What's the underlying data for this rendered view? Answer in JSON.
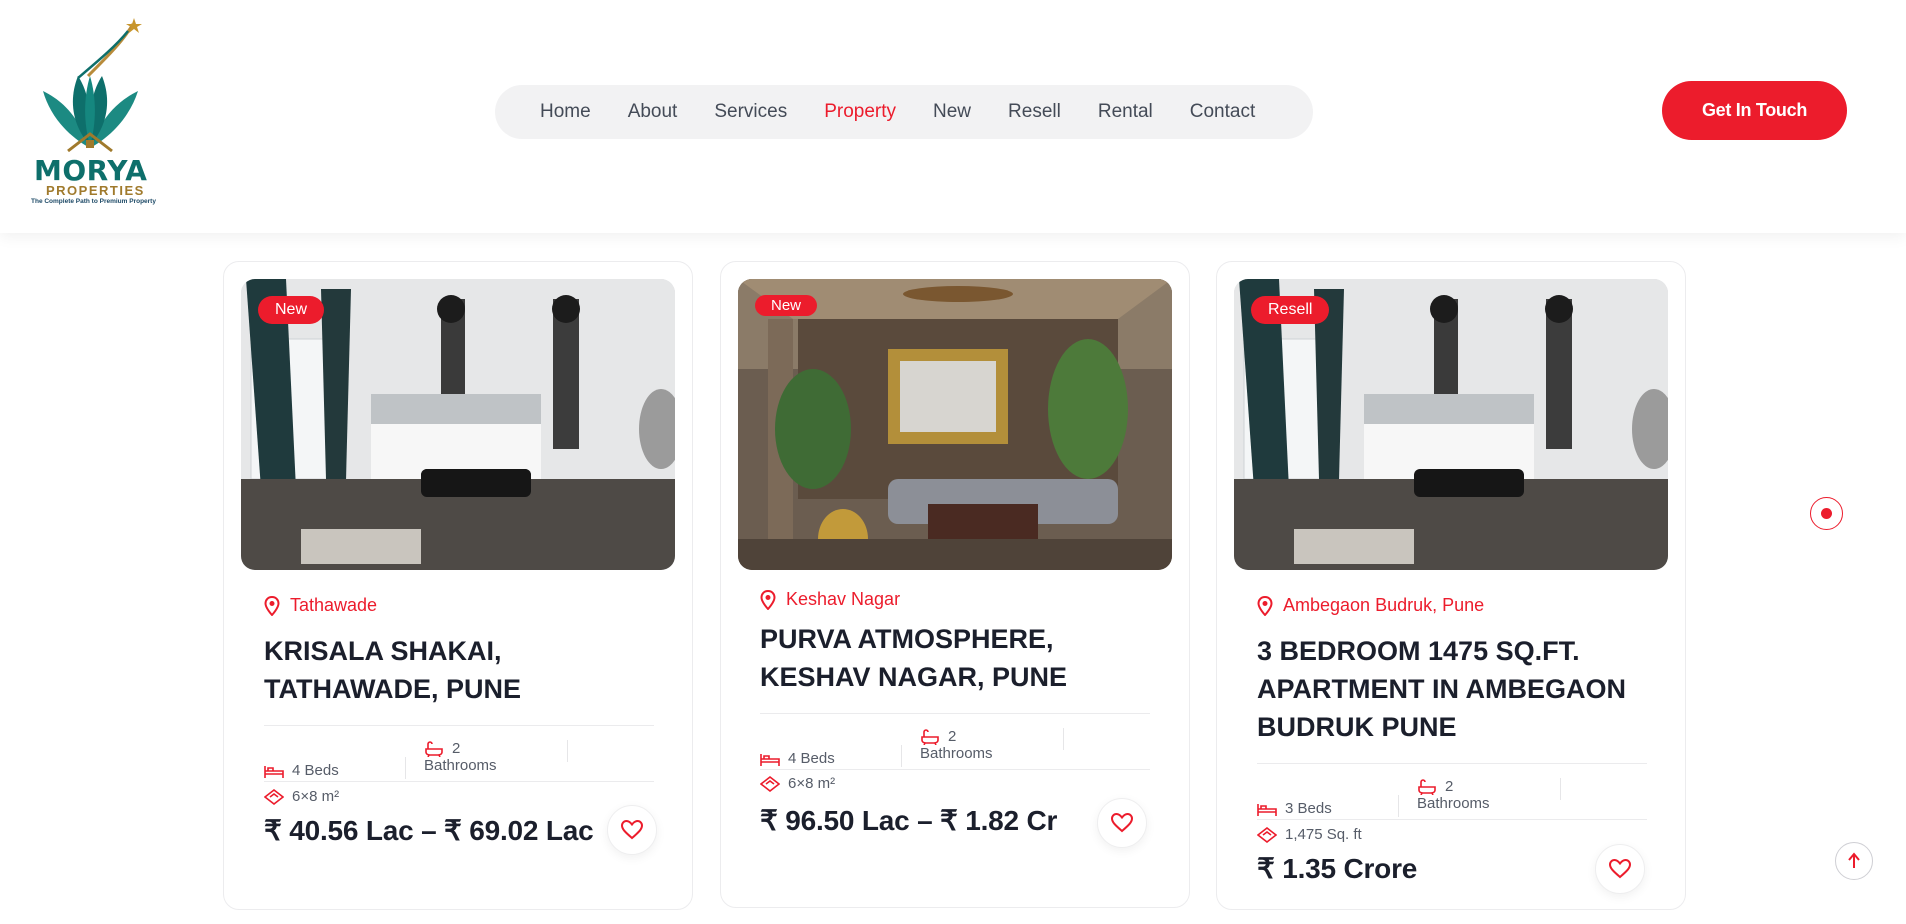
{
  "logo": {
    "name": "MORYA",
    "sub": "PROPERTIES",
    "tagline": "The Complete Path to Premium Property"
  },
  "nav": {
    "items": [
      {
        "label": "Home"
      },
      {
        "label": "About"
      },
      {
        "label": "Services"
      },
      {
        "label": "Property"
      },
      {
        "label": "New"
      },
      {
        "label": "Resell"
      },
      {
        "label": "Rental"
      },
      {
        "label": "Contact"
      }
    ],
    "active": "Property"
  },
  "cta_label": "Get In Touch",
  "colors": {
    "accent": "#ec1c2c",
    "text": "#1b1f2c",
    "nav_bg": "#f2f2f3"
  },
  "cards": [
    {
      "badge": "New",
      "location": "Tathawade",
      "title": "KRISALA SHAKAI, TATHAWADE, PUNE",
      "beds": "4 Beds",
      "baths_count": "2",
      "baths_label": "Bathrooms",
      "area": "6×8 m²",
      "price": "₹ 40.56 Lac – ₹ 69.02 Lac",
      "image": "bedroom-photo"
    },
    {
      "badge": "New",
      "location": "Keshav Nagar",
      "title": "PURVA ATMOSPHERE, KESHAV NAGAR, PUNE",
      "beds": "4 Beds",
      "baths_count": "2",
      "baths_label": "Bathrooms",
      "area": "6×8 m²",
      "price": "₹ 96.50 Lac – ₹ 1.82 Cr",
      "image": "living-room-photo"
    },
    {
      "badge": "Resell",
      "location": "Ambegaon Budruk, Pune",
      "title": "3 BEDROOM 1475 SQ.FT. APARTMENT IN AMBEGAON BUDRUK PUNE",
      "beds": "3 Beds",
      "baths_count": "2",
      "baths_label": "Bathrooms",
      "area": "1,475 Sq. ft",
      "price": "₹ 1.35 Crore",
      "image": "bedroom-photo"
    }
  ]
}
